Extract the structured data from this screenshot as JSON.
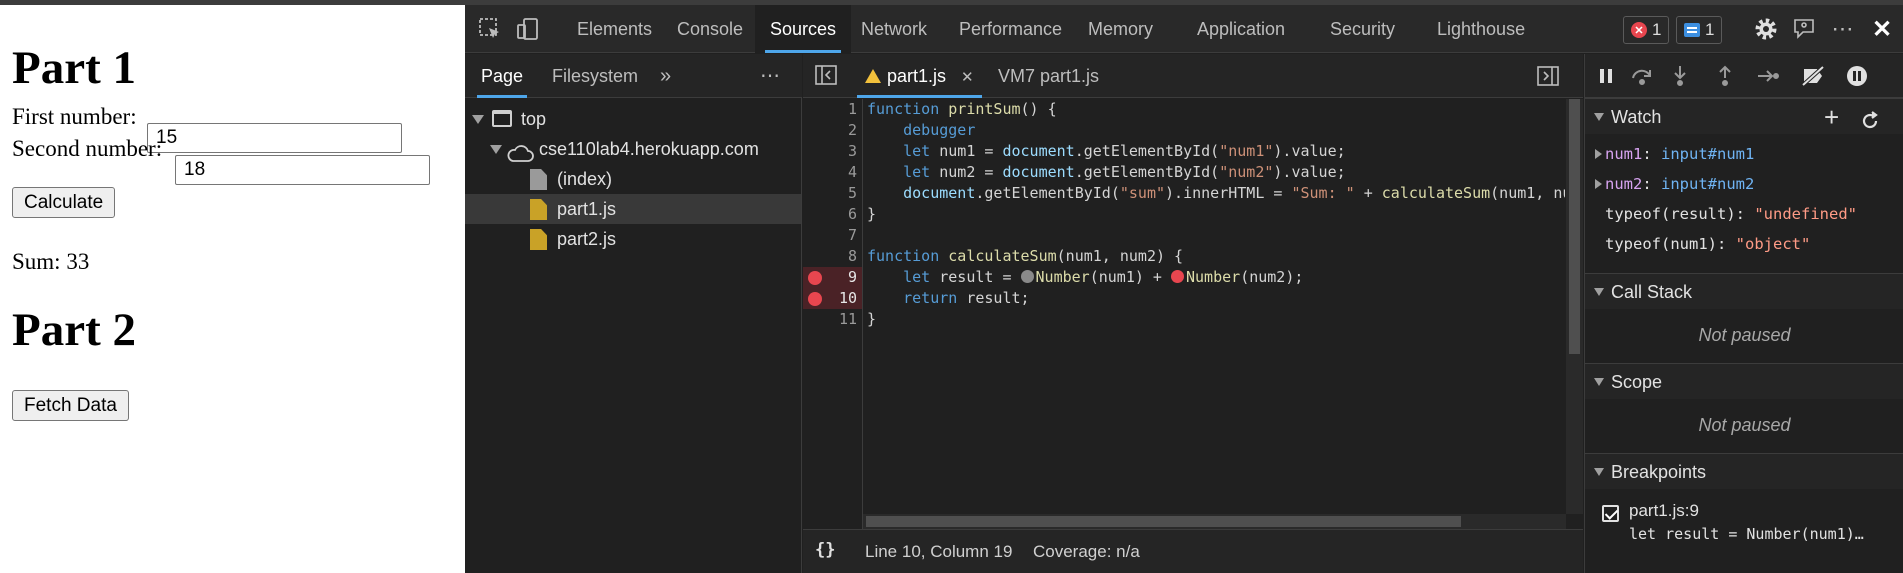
{
  "webpage": {
    "part1_title": "Part 1",
    "first_label": "First number:",
    "first_value": "15",
    "second_label": "Second number:",
    "second_value": "18",
    "calculate_label": "Calculate",
    "sum_text": "Sum: 33",
    "part2_title": "Part 2",
    "fetch_label": "Fetch Data"
  },
  "devtools": {
    "tabs": [
      "Elements",
      "Console",
      "Sources",
      "Network",
      "Performance",
      "Memory",
      "Application",
      "Security",
      "Lighthouse"
    ],
    "active_tab": "Sources",
    "error_count": "1",
    "message_count": "1",
    "navigator": {
      "tabs": [
        "Page",
        "Filesystem"
      ],
      "tree": {
        "top": "top",
        "host": "cse110lab4.herokuapp.com",
        "files": [
          "(index)",
          "part1.js",
          "part2.js"
        ]
      }
    },
    "editor": {
      "tabs": [
        "part1.js",
        "VM7 part1.js"
      ],
      "line_numbers": [
        "1",
        "2",
        "3",
        "4",
        "5",
        "6",
        "7",
        "8",
        "9",
        "10",
        "11"
      ],
      "status": {
        "position": "Line 10, Column 19",
        "coverage": "Coverage: n/a"
      }
    },
    "debugger": {
      "watch": {
        "title": "Watch",
        "items": [
          {
            "name": "num1",
            "value": "input#num1"
          },
          {
            "name": "num2",
            "value": "input#num2"
          },
          {
            "name": "typeof(result)",
            "value": "\"undefined\""
          },
          {
            "name": "typeof(num1)",
            "value": "\"object\""
          }
        ]
      },
      "call_stack": {
        "title": "Call Stack",
        "status": "Not paused"
      },
      "scope": {
        "title": "Scope",
        "status": "Not paused"
      },
      "breakpoints": {
        "title": "Breakpoints",
        "items": [
          {
            "location": "part1.js:9",
            "code": "let result = Number(num1)…"
          }
        ]
      }
    }
  },
  "colors": {
    "accent": "#4ea6ea",
    "breakpoint": "#e8464f",
    "panel_bg": "#202020"
  }
}
